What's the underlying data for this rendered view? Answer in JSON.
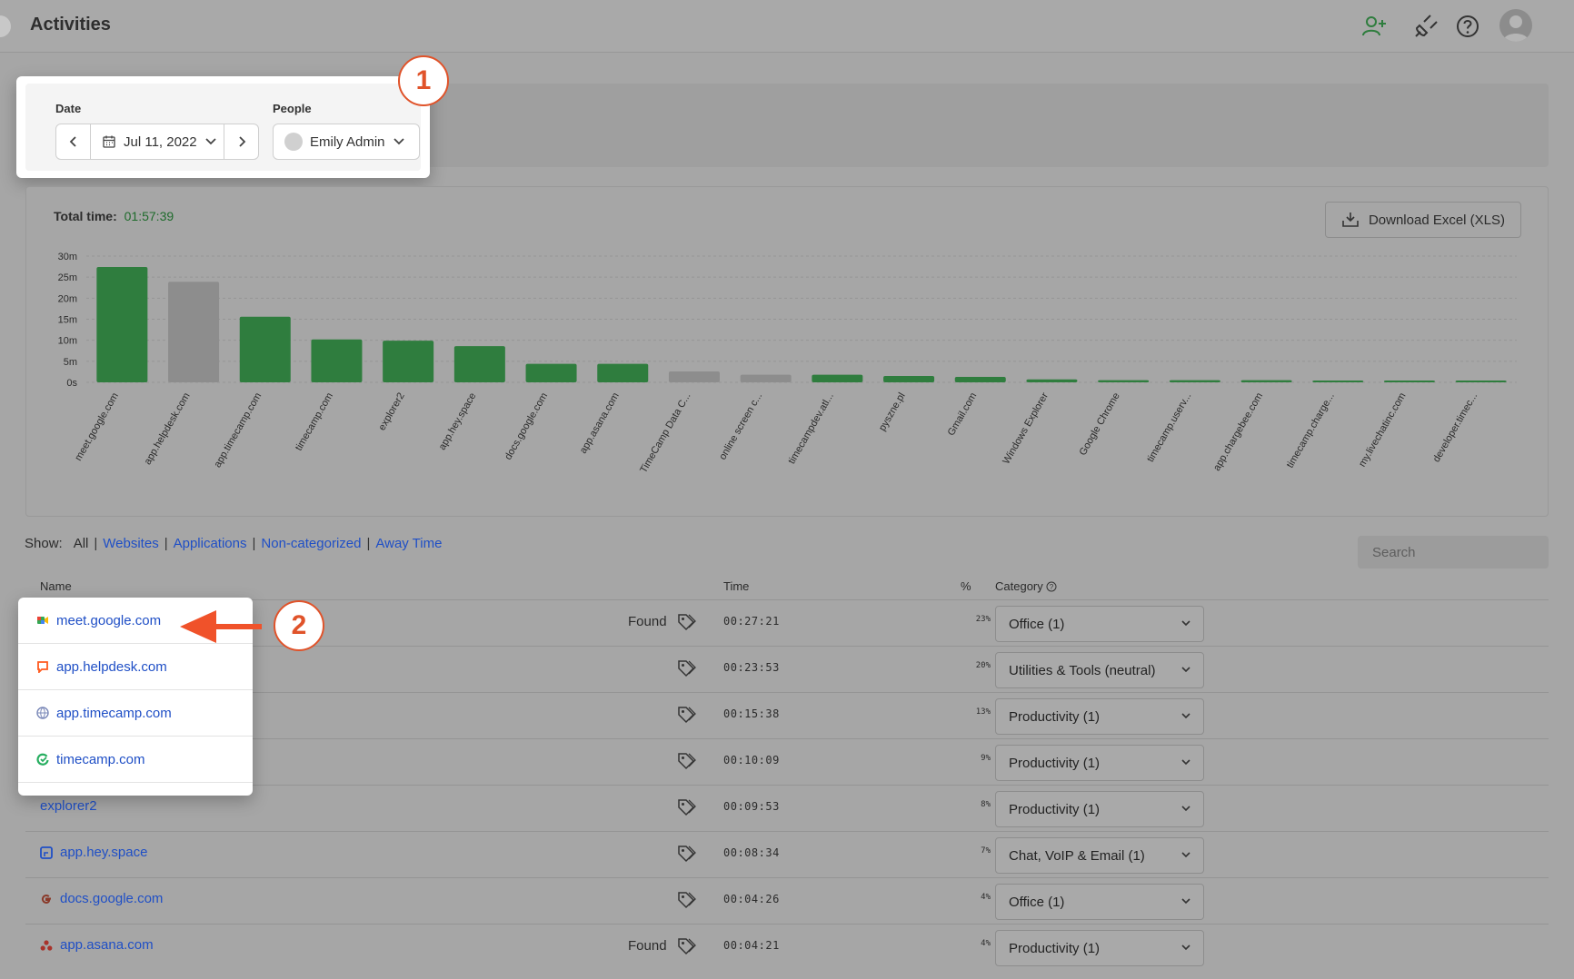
{
  "header": {
    "title": "Activities"
  },
  "filters": {
    "date_label": "Date",
    "date_value": "Jul 11, 2022",
    "people_label": "People",
    "people_value": "Emily Admin"
  },
  "callouts": {
    "one": "1",
    "two": "2"
  },
  "summary": {
    "total_label": "Total time:",
    "total_value": "01:57:39",
    "download_label": "Download Excel (XLS)"
  },
  "chart_data": {
    "type": "bar",
    "yticks": [
      "30m",
      "25m",
      "20m",
      "15m",
      "10m",
      "5m",
      "0s"
    ],
    "ylim": [
      0,
      30
    ],
    "categories": [
      "meet.google.com",
      "app.helpdesk.com",
      "app.timecamp.com",
      "timecamp.com",
      "explorer2",
      "app.hey.space",
      "docs.google.com",
      "app.asana.com",
      "TimeCamp Data C...",
      "online screen c...",
      "timecampdev.atl...",
      "pyszne.pl",
      "Gmail.com",
      "Windows Explorer",
      "Google Chrome",
      "timecamp.userv...",
      "app.chargebee.com",
      "timecamp.charge...",
      "my.livechatinc.com",
      "developer.timec..."
    ],
    "values": [
      27.4,
      23.9,
      15.6,
      10.2,
      9.9,
      8.6,
      4.4,
      4.4,
      2.6,
      1.8,
      1.8,
      1.5,
      1.3,
      0.7,
      0.5,
      0.5,
      0.5,
      0.3,
      0.3,
      0.2
    ],
    "colors": [
      "#2f7d3e",
      "#8d8d8d",
      "#2f7d3e",
      "#2f7d3e",
      "#2f7d3e",
      "#2f7d3e",
      "#2f7d3e",
      "#2f7d3e",
      "#8d8d8d",
      "#8d8d8d",
      "#2f7d3e",
      "#2f7d3e",
      "#2f7d3e",
      "#2f7d3e",
      "#2f7d3e",
      "#2f7d3e",
      "#2f7d3e",
      "#2f7d3e",
      "#2f7d3e",
      "#2f7d3e"
    ],
    "grid": true
  },
  "show": {
    "label": "Show:",
    "options": [
      "All",
      "Websites",
      "Applications",
      "Non-categorized",
      "Away Time"
    ],
    "search_placeholder": "Search"
  },
  "table": {
    "headers": {
      "name": "Name",
      "time": "Time",
      "pct": "%",
      "category": "Category"
    },
    "rows": [
      {
        "name": "meet.google.com",
        "found": "Found",
        "time": "00:27:21",
        "pct": "23%",
        "category": "Office (1)"
      },
      {
        "name": "app.helpdesk.com",
        "found": "",
        "time": "00:23:53",
        "pct": "20%",
        "category": "Utilities & Tools (neutral)"
      },
      {
        "name": "app.timecamp.com",
        "found": "",
        "time": "00:15:38",
        "pct": "13%",
        "category": "Productivity (1)"
      },
      {
        "name": "timecamp.com",
        "found": "",
        "time": "00:10:09",
        "pct": "9%",
        "category": "Productivity (1)"
      },
      {
        "name": "explorer2",
        "found": "",
        "time": "00:09:53",
        "pct": "8%",
        "category": "Productivity (1)"
      },
      {
        "name": "app.hey.space",
        "found": "",
        "time": "00:08:34",
        "pct": "7%",
        "category": "Chat, VoIP & Email (1)"
      },
      {
        "name": "docs.google.com",
        "found": "",
        "time": "00:04:26",
        "pct": "4%",
        "category": "Office (1)"
      },
      {
        "name": "app.asana.com",
        "found": "Found",
        "time": "00:04:21",
        "pct": "4%",
        "category": "Productivity (1)"
      }
    ]
  }
}
